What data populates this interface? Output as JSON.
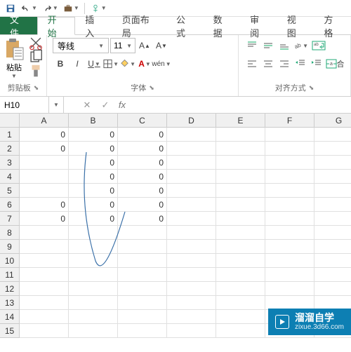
{
  "qat": {
    "save": "save-icon",
    "undo": "undo-icon",
    "redo": "redo-icon",
    "touch": "touch-icon"
  },
  "tabs": {
    "file": "文件",
    "home": "开始",
    "insert": "插入",
    "pagelayout": "页面布局",
    "formulas": "公式",
    "data": "数据",
    "review": "审阅",
    "view": "视图",
    "format": "方格"
  },
  "ribbon": {
    "clipboard": {
      "paste": "粘贴",
      "label": "剪贴板"
    },
    "font": {
      "name": "等线",
      "size": "11",
      "bold": "B",
      "italic": "I",
      "underline": "U",
      "wen": "wén",
      "label": "字体"
    },
    "align": {
      "merge": "合",
      "label": "对齐方式"
    }
  },
  "namebox": {
    "ref": "H10",
    "cancel": "✕",
    "confirm": "✓",
    "fx": "fx"
  },
  "grid": {
    "cols": [
      "A",
      "B",
      "C",
      "D",
      "E",
      "F",
      "G"
    ],
    "rows": [
      "1",
      "2",
      "3",
      "4",
      "5",
      "6",
      "7",
      "8",
      "9",
      "10",
      "11",
      "12",
      "13",
      "14",
      "15"
    ],
    "data": [
      [
        "0",
        "0",
        "0",
        "",
        "",
        "",
        ""
      ],
      [
        "0",
        "0",
        "0",
        "",
        "",
        "",
        ""
      ],
      [
        "",
        "0",
        "0",
        "",
        "",
        "",
        ""
      ],
      [
        "",
        "0",
        "0",
        "",
        "",
        "",
        ""
      ],
      [
        "",
        "0",
        "0",
        "",
        "",
        "",
        ""
      ],
      [
        "0",
        "0",
        "0",
        "",
        "",
        "",
        ""
      ],
      [
        "0",
        "0",
        "0",
        "",
        "",
        "",
        ""
      ],
      [
        "",
        "",
        "",
        "",
        "",
        "",
        ""
      ],
      [
        "",
        "",
        "",
        "",
        "",
        "",
        ""
      ],
      [
        "",
        "",
        "",
        "",
        "",
        "",
        ""
      ],
      [
        "",
        "",
        "",
        "",
        "",
        "",
        ""
      ],
      [
        "",
        "",
        "",
        "",
        "",
        "",
        ""
      ],
      [
        "",
        "",
        "",
        "",
        "",
        "",
        ""
      ],
      [
        "",
        "",
        "",
        "",
        "",
        "",
        ""
      ],
      [
        "",
        "",
        "",
        "",
        "",
        "",
        ""
      ]
    ]
  },
  "watermark": {
    "text": "溜溜自学",
    "url": "zixue.3d66.com"
  }
}
